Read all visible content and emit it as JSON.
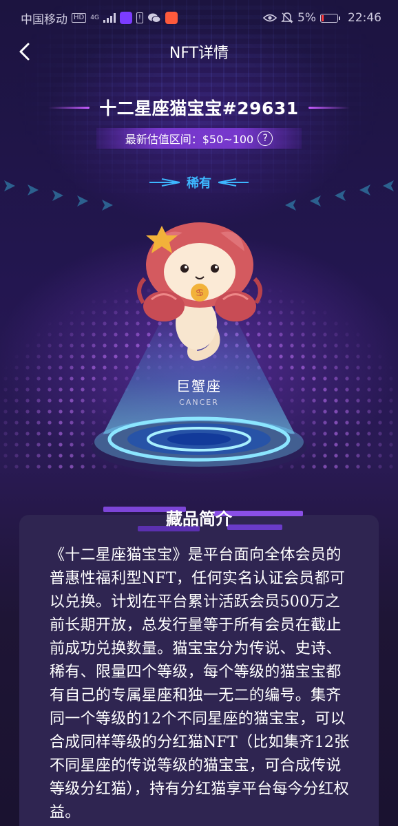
{
  "status_bar": {
    "carrier": "中国移动",
    "hd_badge": "HD",
    "network": "4G",
    "battery_percent": "5%",
    "time": "22:46",
    "icons": [
      "signal-icon",
      "app-icon",
      "alert-icon",
      "wechat-icon",
      "app-icon-2",
      "eye-icon",
      "mute-icon",
      "battery-icon"
    ]
  },
  "header": {
    "title": "NFT详情",
    "back_icon": "chevron-left-icon"
  },
  "nft": {
    "title": "十二星座猫宝宝#29631",
    "valuation": "最新估值区间：$50~100",
    "help_icon": "?",
    "rarity": "稀有",
    "zodiac_cn": "巨蟹座",
    "zodiac_en": "CANCER"
  },
  "intro": {
    "heading": "藏品简介",
    "body": "《十二星座猫宝宝》是平台面向全体会员的普惠性福利型NFT，任何实名认证会员都可以兑换。计划在平台累计活跃会员500万之前长期开放，总发行量等于所有会员在截止前成功兑换数量。猫宝宝分为传说、史诗、稀有、限量四个等级，每个等级的猫宝宝都有自己的专属星座和独一无二的编号。集齐同一个等级的12个不同星座的猫宝宝，可以合成同样等级的分红猫NFT（比如集齐12张不同星座的传说等级的猫宝宝，可合成传说等级分红猫），持有分红猫享平台每今分红权益。"
  },
  "colors": {
    "accent_purple": "#c65cff",
    "rarity_blue": "#3db7ff",
    "card_bg": "#2f2551",
    "battery_low": "#ff3b3b"
  }
}
